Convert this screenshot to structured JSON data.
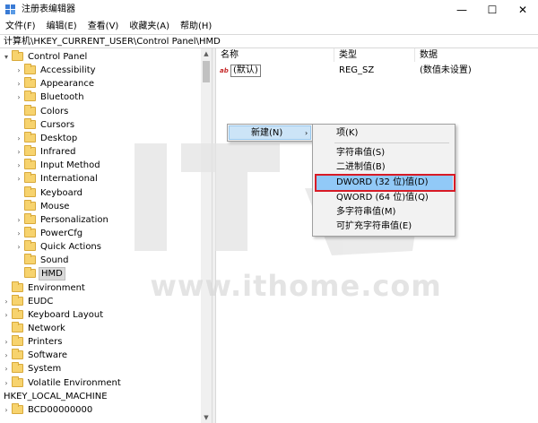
{
  "window": {
    "title": "注册表编辑器",
    "controls": {
      "minimize": "—",
      "maximize": "☐",
      "close": "✕"
    }
  },
  "menubar": [
    "文件(F)",
    "编辑(E)",
    "查看(V)",
    "收藏夹(A)",
    "帮助(H)"
  ],
  "address": "计算机\\HKEY_CURRENT_USER\\Control Panel\\HMD",
  "tree": [
    {
      "label": "Control Panel",
      "level": 0,
      "expander": "▾"
    },
    {
      "label": "Accessibility",
      "level": 1,
      "expander": "›"
    },
    {
      "label": "Appearance",
      "level": 1,
      "expander": "›"
    },
    {
      "label": "Bluetooth",
      "level": 1,
      "expander": "›"
    },
    {
      "label": "Colors",
      "level": 1,
      "expander": ""
    },
    {
      "label": "Cursors",
      "level": 1,
      "expander": ""
    },
    {
      "label": "Desktop",
      "level": 1,
      "expander": "›"
    },
    {
      "label": "Infrared",
      "level": 1,
      "expander": "›"
    },
    {
      "label": "Input Method",
      "level": 1,
      "expander": "›"
    },
    {
      "label": "International",
      "level": 1,
      "expander": "›"
    },
    {
      "label": "Keyboard",
      "level": 1,
      "expander": ""
    },
    {
      "label": "Mouse",
      "level": 1,
      "expander": ""
    },
    {
      "label": "Personalization",
      "level": 1,
      "expander": "›"
    },
    {
      "label": "PowerCfg",
      "level": 1,
      "expander": "›"
    },
    {
      "label": "Quick Actions",
      "level": 1,
      "expander": "›"
    },
    {
      "label": "Sound",
      "level": 1,
      "expander": ""
    },
    {
      "label": "HMD",
      "level": 1,
      "expander": "",
      "selected": true
    },
    {
      "label": "Environment",
      "level": 0,
      "expander": ""
    },
    {
      "label": "EUDC",
      "level": 0,
      "expander": "›"
    },
    {
      "label": "Keyboard Layout",
      "level": 0,
      "expander": "›"
    },
    {
      "label": "Network",
      "level": 0,
      "expander": ""
    },
    {
      "label": "Printers",
      "level": 0,
      "expander": "›"
    },
    {
      "label": "Software",
      "level": 0,
      "expander": "›"
    },
    {
      "label": "System",
      "level": 0,
      "expander": "›"
    },
    {
      "label": "Volatile Environment",
      "level": 0,
      "expander": "›"
    },
    {
      "label": "HKEY_LOCAL_MACHINE",
      "level": -1,
      "expander": "▾",
      "noicon": true
    },
    {
      "label": "BCD00000000",
      "level": 0,
      "expander": "›"
    }
  ],
  "columns": {
    "name": "名称",
    "type": "类型",
    "data": "数据"
  },
  "values": [
    {
      "icon": "ab",
      "name": "(默认)",
      "type": "REG_SZ",
      "data": "(数值未设置)"
    }
  ],
  "context_menu": {
    "new_label": "新建(N)",
    "arrow": "›",
    "submenu": [
      "项(K)",
      "字符串值(S)",
      "二进制值(B)",
      "DWORD (32 位)值(D)",
      "QWORD (64 位)值(Q)",
      "多字符串值(M)",
      "可扩充字符串值(E)"
    ],
    "highlighted_index": 3
  },
  "watermark": "www.ithome.com",
  "colors": {
    "highlight_box": "#d81b26",
    "selection": "#91c9f7",
    "folder": "#f7d36e"
  }
}
